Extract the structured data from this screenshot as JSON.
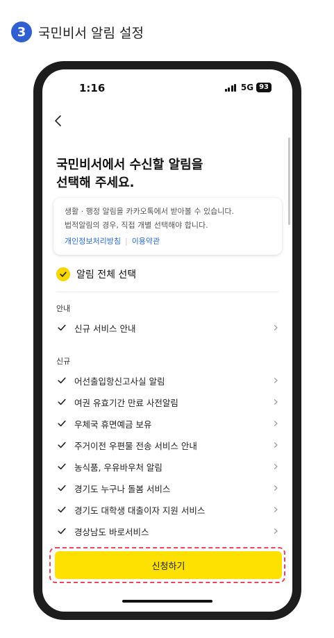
{
  "step": {
    "number": "3",
    "title": "국민비서 알림 설정",
    "badge_color": "#2f5fd0"
  },
  "status_bar": {
    "time": "1:16",
    "network": "5G",
    "battery": "93"
  },
  "nav": {
    "back_icon": "chevron-left-icon"
  },
  "page": {
    "title_line1": "국민비서에서 수신할 알림을",
    "title_line2": "선택해 주세요."
  },
  "info_box": {
    "line1": "생활 · 행정 알림을 카카오톡에서 받아볼 수 있습니다.",
    "line2": "법적알림의 경우, 직접 개별 선택해야 합니다.",
    "link_privacy": "개인정보처리방침",
    "link_terms": "이용약관"
  },
  "select_all": {
    "label": "알림 전체 선택",
    "checked": true
  },
  "sections": {
    "guide": {
      "title": "안내",
      "items": [
        {
          "label": "신규 서비스 안내",
          "checked": true
        }
      ]
    },
    "new": {
      "title": "신규",
      "items": [
        {
          "label": "어선출입항신고사실 알림",
          "checked": true
        },
        {
          "label": "여권 유효기간 만료 사전알림",
          "checked": true
        },
        {
          "label": "우체국 휴면예금 보유",
          "checked": true
        },
        {
          "label": "주거이전 우편물 전송 서비스 안내",
          "checked": true
        },
        {
          "label": "농식품, 우유바우처 알림",
          "checked": true
        },
        {
          "label": "경기도 누구나 돌봄 서비스",
          "checked": true
        },
        {
          "label": "경기도 대학생 대출이자 지원 서비스",
          "checked": true
        },
        {
          "label": "경상남도 바로서비스",
          "checked": true
        }
      ]
    }
  },
  "cta": {
    "label": "신청하기",
    "color": "#ffe100",
    "highlight_color": "#e8465a"
  }
}
